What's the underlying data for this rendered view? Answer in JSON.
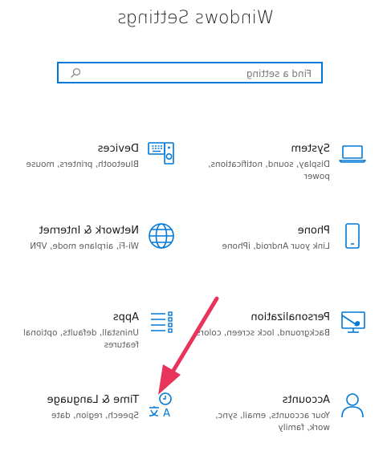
{
  "page": {
    "title": "Windows Settings"
  },
  "search": {
    "placeholder": "Find a setting",
    "value": ""
  },
  "categories": [
    {
      "name": "System",
      "description": "Display, sound, notifications, power",
      "icon": "laptop-icon"
    },
    {
      "name": "Devices",
      "description": "Bluetooth, printers, mouse",
      "icon": "keyboard-speaker-icon"
    },
    {
      "name": "Phone",
      "description": "Link your Android, iPhone",
      "icon": "phone-icon"
    },
    {
      "name": "Network & Internet",
      "description": "Wi-Fi, airplane mode, VPN",
      "icon": "globe-icon"
    },
    {
      "name": "Personalization",
      "description": "Background, lock screen, colors",
      "icon": "paint-brush-icon"
    },
    {
      "name": "Apps",
      "description": "Uninstall, defaults, optional features",
      "icon": "apps-list-icon"
    },
    {
      "name": "Accounts",
      "description": "Your accounts, email, sync, work, family",
      "icon": "person-icon"
    },
    {
      "name": "Time & Language",
      "description": "Speech, region, date",
      "icon": "time-language-icon"
    }
  ],
  "colors": {
    "accent": "#0078d7",
    "annotation_arrow": "#e8345a"
  }
}
